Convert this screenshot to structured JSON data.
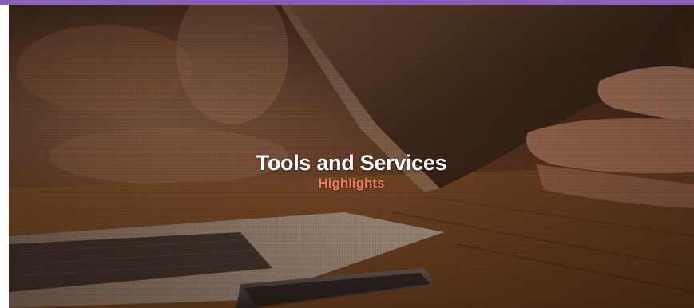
{
  "header": {
    "accent_color": "#8a5fb7"
  },
  "hero": {
    "title": "Tools and Services",
    "subtitle": "Highlights",
    "title_color": "#ffffff",
    "subtitle_color": "#ee7a5e",
    "background_image": "laptop-tablet-hands-photo"
  }
}
